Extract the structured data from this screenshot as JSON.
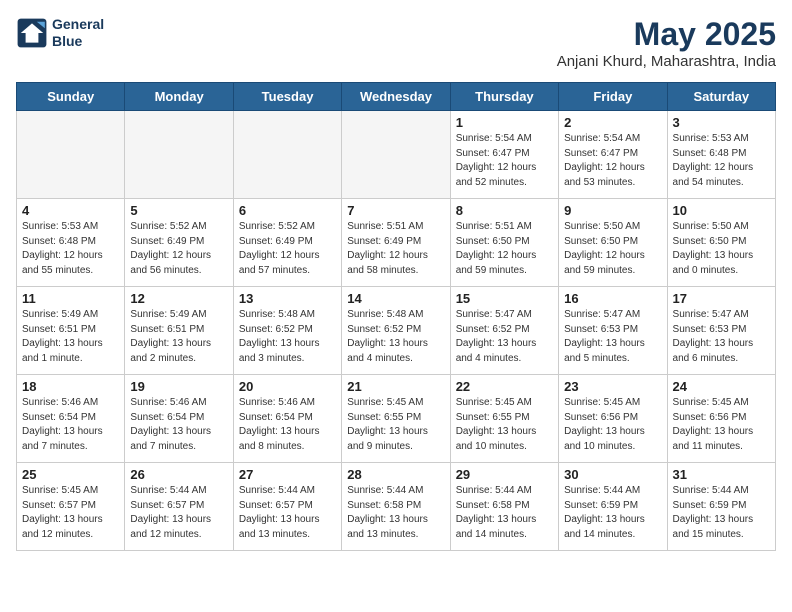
{
  "header": {
    "logo_line1": "General",
    "logo_line2": "Blue",
    "month_year": "May 2025",
    "location": "Anjani Khurd, Maharashtra, India"
  },
  "weekdays": [
    "Sunday",
    "Monday",
    "Tuesday",
    "Wednesday",
    "Thursday",
    "Friday",
    "Saturday"
  ],
  "weeks": [
    [
      {
        "day": "",
        "content": ""
      },
      {
        "day": "",
        "content": ""
      },
      {
        "day": "",
        "content": ""
      },
      {
        "day": "",
        "content": ""
      },
      {
        "day": "1",
        "content": "Sunrise: 5:54 AM\nSunset: 6:47 PM\nDaylight: 12 hours\nand 52 minutes."
      },
      {
        "day": "2",
        "content": "Sunrise: 5:54 AM\nSunset: 6:47 PM\nDaylight: 12 hours\nand 53 minutes."
      },
      {
        "day": "3",
        "content": "Sunrise: 5:53 AM\nSunset: 6:48 PM\nDaylight: 12 hours\nand 54 minutes."
      }
    ],
    [
      {
        "day": "4",
        "content": "Sunrise: 5:53 AM\nSunset: 6:48 PM\nDaylight: 12 hours\nand 55 minutes."
      },
      {
        "day": "5",
        "content": "Sunrise: 5:52 AM\nSunset: 6:49 PM\nDaylight: 12 hours\nand 56 minutes."
      },
      {
        "day": "6",
        "content": "Sunrise: 5:52 AM\nSunset: 6:49 PM\nDaylight: 12 hours\nand 57 minutes."
      },
      {
        "day": "7",
        "content": "Sunrise: 5:51 AM\nSunset: 6:49 PM\nDaylight: 12 hours\nand 58 minutes."
      },
      {
        "day": "8",
        "content": "Sunrise: 5:51 AM\nSunset: 6:50 PM\nDaylight: 12 hours\nand 59 minutes."
      },
      {
        "day": "9",
        "content": "Sunrise: 5:50 AM\nSunset: 6:50 PM\nDaylight: 12 hours\nand 59 minutes."
      },
      {
        "day": "10",
        "content": "Sunrise: 5:50 AM\nSunset: 6:50 PM\nDaylight: 13 hours\nand 0 minutes."
      }
    ],
    [
      {
        "day": "11",
        "content": "Sunrise: 5:49 AM\nSunset: 6:51 PM\nDaylight: 13 hours\nand 1 minute."
      },
      {
        "day": "12",
        "content": "Sunrise: 5:49 AM\nSunset: 6:51 PM\nDaylight: 13 hours\nand 2 minutes."
      },
      {
        "day": "13",
        "content": "Sunrise: 5:48 AM\nSunset: 6:52 PM\nDaylight: 13 hours\nand 3 minutes."
      },
      {
        "day": "14",
        "content": "Sunrise: 5:48 AM\nSunset: 6:52 PM\nDaylight: 13 hours\nand 4 minutes."
      },
      {
        "day": "15",
        "content": "Sunrise: 5:47 AM\nSunset: 6:52 PM\nDaylight: 13 hours\nand 4 minutes."
      },
      {
        "day": "16",
        "content": "Sunrise: 5:47 AM\nSunset: 6:53 PM\nDaylight: 13 hours\nand 5 minutes."
      },
      {
        "day": "17",
        "content": "Sunrise: 5:47 AM\nSunset: 6:53 PM\nDaylight: 13 hours\nand 6 minutes."
      }
    ],
    [
      {
        "day": "18",
        "content": "Sunrise: 5:46 AM\nSunset: 6:54 PM\nDaylight: 13 hours\nand 7 minutes."
      },
      {
        "day": "19",
        "content": "Sunrise: 5:46 AM\nSunset: 6:54 PM\nDaylight: 13 hours\nand 7 minutes."
      },
      {
        "day": "20",
        "content": "Sunrise: 5:46 AM\nSunset: 6:54 PM\nDaylight: 13 hours\nand 8 minutes."
      },
      {
        "day": "21",
        "content": "Sunrise: 5:45 AM\nSunset: 6:55 PM\nDaylight: 13 hours\nand 9 minutes."
      },
      {
        "day": "22",
        "content": "Sunrise: 5:45 AM\nSunset: 6:55 PM\nDaylight: 13 hours\nand 10 minutes."
      },
      {
        "day": "23",
        "content": "Sunrise: 5:45 AM\nSunset: 6:56 PM\nDaylight: 13 hours\nand 10 minutes."
      },
      {
        "day": "24",
        "content": "Sunrise: 5:45 AM\nSunset: 6:56 PM\nDaylight: 13 hours\nand 11 minutes."
      }
    ],
    [
      {
        "day": "25",
        "content": "Sunrise: 5:45 AM\nSunset: 6:57 PM\nDaylight: 13 hours\nand 12 minutes."
      },
      {
        "day": "26",
        "content": "Sunrise: 5:44 AM\nSunset: 6:57 PM\nDaylight: 13 hours\nand 12 minutes."
      },
      {
        "day": "27",
        "content": "Sunrise: 5:44 AM\nSunset: 6:57 PM\nDaylight: 13 hours\nand 13 minutes."
      },
      {
        "day": "28",
        "content": "Sunrise: 5:44 AM\nSunset: 6:58 PM\nDaylight: 13 hours\nand 13 minutes."
      },
      {
        "day": "29",
        "content": "Sunrise: 5:44 AM\nSunset: 6:58 PM\nDaylight: 13 hours\nand 14 minutes."
      },
      {
        "day": "30",
        "content": "Sunrise: 5:44 AM\nSunset: 6:59 PM\nDaylight: 13 hours\nand 14 minutes."
      },
      {
        "day": "31",
        "content": "Sunrise: 5:44 AM\nSunset: 6:59 PM\nDaylight: 13 hours\nand 15 minutes."
      }
    ]
  ]
}
